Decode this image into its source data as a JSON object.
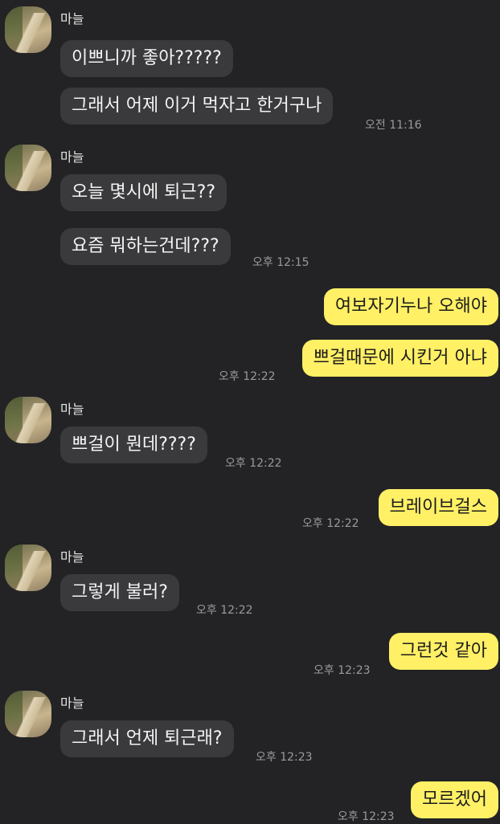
{
  "sender_name": "마늘",
  "messages": [
    {
      "text": "이쁘니까 좋아?????"
    },
    {
      "text": "그래서 어제 이거 먹자고 한거구나",
      "time": "오전 11:16"
    },
    {
      "text": "오늘 몇시에 퇴근??"
    },
    {
      "text": "요즘 뭐하는건데???",
      "time": "오후 12:15"
    },
    {
      "text": "여보자기누나 오해야"
    },
    {
      "text": "쁘걸때문에 시킨거 아냐",
      "time": "오후 12:22"
    },
    {
      "text": "쁘걸이 뭔데????",
      "time": "오후 12:22"
    },
    {
      "text": "브레이브걸스",
      "time": "오후 12:22"
    },
    {
      "text": "그렇게 불러?",
      "time": "오후 12:22"
    },
    {
      "text": "그런것 같아",
      "time": "오후 12:23"
    },
    {
      "text": "그래서 언제 퇴근래?",
      "time": "오후 12:23"
    },
    {
      "text": "모르겠어",
      "time": "오후 12:23"
    }
  ]
}
